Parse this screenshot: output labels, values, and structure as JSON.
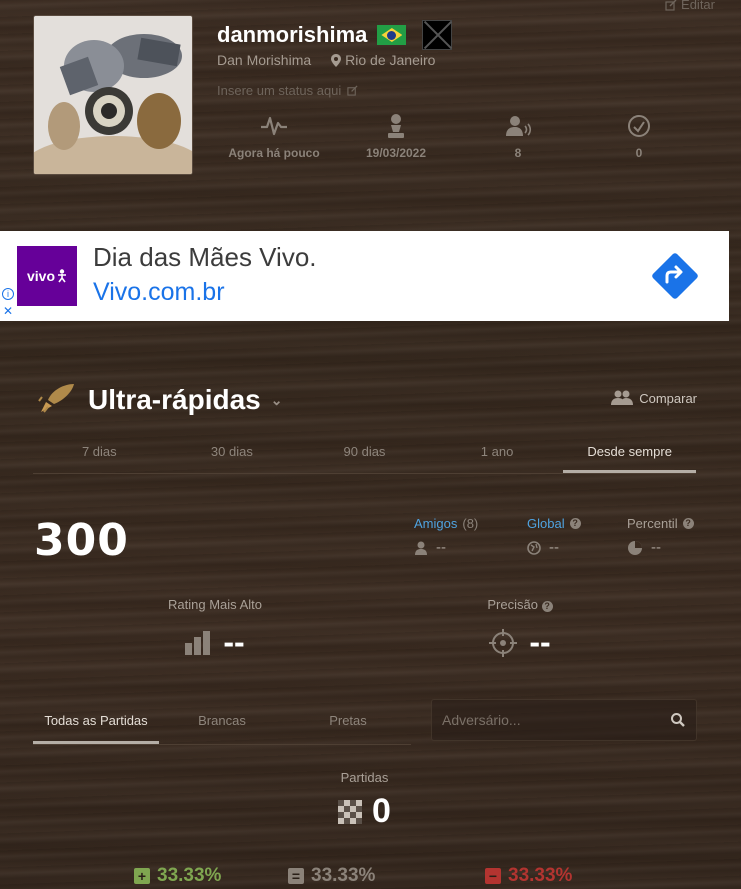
{
  "header": {
    "edit_label": "Editar",
    "username": "danmorishima",
    "real_name": "Dan Morishima",
    "location": "Rio de Janeiro",
    "status_placeholder": "Insere um status aqui",
    "stats": [
      {
        "icon": "activity-icon",
        "value": "Agora há pouco"
      },
      {
        "icon": "pawn-icon",
        "value": "19/03/2022"
      },
      {
        "icon": "followers-icon",
        "value": "8"
      },
      {
        "icon": "points-icon",
        "value": "0"
      }
    ]
  },
  "ad": {
    "logo_text": "vivo",
    "title": "Dia das Mães Vivo.",
    "url": "Vivo.com.br",
    "brand_color": "#660099"
  },
  "mode": {
    "title": "Ultra-rápidas",
    "compare_label": "Comparar",
    "periods": [
      "7 dias",
      "30 dias",
      "90 dias",
      "1 ano",
      "Desde sempre"
    ],
    "active_period": "Desde sempre"
  },
  "rating": {
    "current": "300",
    "friends_label": "Amigos",
    "friends_count": "(8)",
    "friends_value": "--",
    "global_label": "Global",
    "global_value": "--",
    "percentile_label": "Percentil",
    "percentile_value": "--",
    "highest_label": "Rating Mais Alto",
    "highest_value": "--",
    "accuracy_label": "Precisão",
    "accuracy_value": "--"
  },
  "games": {
    "tabs": [
      "Todas as Partidas",
      "Brancas",
      "Pretas"
    ],
    "active_tab": "Todas as Partidas",
    "opponent_placeholder": "Adversário...",
    "games_label": "Partidas",
    "games_count": "0",
    "win_pct": "33.33%",
    "draw_pct": "33.33%",
    "loss_pct": "33.33%"
  },
  "colors": {
    "link_blue": "#4fa3e0",
    "win_green": "#7fa650",
    "draw_gray": "#8b8279",
    "loss_red": "#b33430"
  }
}
